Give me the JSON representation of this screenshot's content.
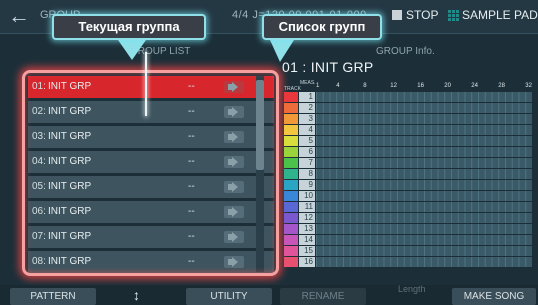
{
  "topbar": {
    "title": "GROUP",
    "status": "4/4  J=120.00  001-01-000",
    "stop_label": "STOP",
    "sample_pad_label": "SAMPLE PAD"
  },
  "callouts": {
    "current_group": "Текущая группа",
    "group_list": "Список групп"
  },
  "group_list": {
    "header": "GROUP LIST",
    "rows": [
      {
        "num": "01:",
        "name": "INIT GRP",
        "dash": "--",
        "selected": true
      },
      {
        "num": "02:",
        "name": "INIT GRP",
        "dash": "--",
        "selected": false
      },
      {
        "num": "03:",
        "name": "INIT GRP",
        "dash": "--",
        "selected": false
      },
      {
        "num": "04:",
        "name": "INIT GRP",
        "dash": "--",
        "selected": false
      },
      {
        "num": "05:",
        "name": "INIT GRP",
        "dash": "--",
        "selected": false
      },
      {
        "num": "06:",
        "name": "INIT GRP",
        "dash": "--",
        "selected": false
      },
      {
        "num": "07:",
        "name": "INIT GRP",
        "dash": "--",
        "selected": false
      },
      {
        "num": "08:",
        "name": "INIT GRP",
        "dash": "--",
        "selected": false
      }
    ]
  },
  "group_info": {
    "header": "GROUP Info.",
    "title": "01 : INIT GRP",
    "meas_label": "MEAS.",
    "track_label": "TRACK",
    "measures": [
      "1",
      "4",
      "8",
      "12",
      "16",
      "20",
      "24",
      "28",
      "32"
    ],
    "tracks": [
      {
        "num": "1",
        "color": "#e8383c"
      },
      {
        "num": "2",
        "color": "#ee6b3a"
      },
      {
        "num": "3",
        "color": "#f29a38"
      },
      {
        "num": "4",
        "color": "#f3c640"
      },
      {
        "num": "5",
        "color": "#d8df3c"
      },
      {
        "num": "6",
        "color": "#9bd33c"
      },
      {
        "num": "7",
        "color": "#4cc24a"
      },
      {
        "num": "8",
        "color": "#2fb38c"
      },
      {
        "num": "9",
        "color": "#2aa6c4"
      },
      {
        "num": "10",
        "color": "#3a86d8"
      },
      {
        "num": "11",
        "color": "#5a68d6"
      },
      {
        "num": "12",
        "color": "#7c58d0"
      },
      {
        "num": "13",
        "color": "#a556c8"
      },
      {
        "num": "14",
        "color": "#c756b8"
      },
      {
        "num": "15",
        "color": "#e0559a"
      },
      {
        "num": "16",
        "color": "#e85070"
      }
    ]
  },
  "bottombar": {
    "pattern": "PATTERN",
    "utility": "UTILITY",
    "rename": "RENAME",
    "length": "Length",
    "make_song": "MAKE SONG"
  }
}
